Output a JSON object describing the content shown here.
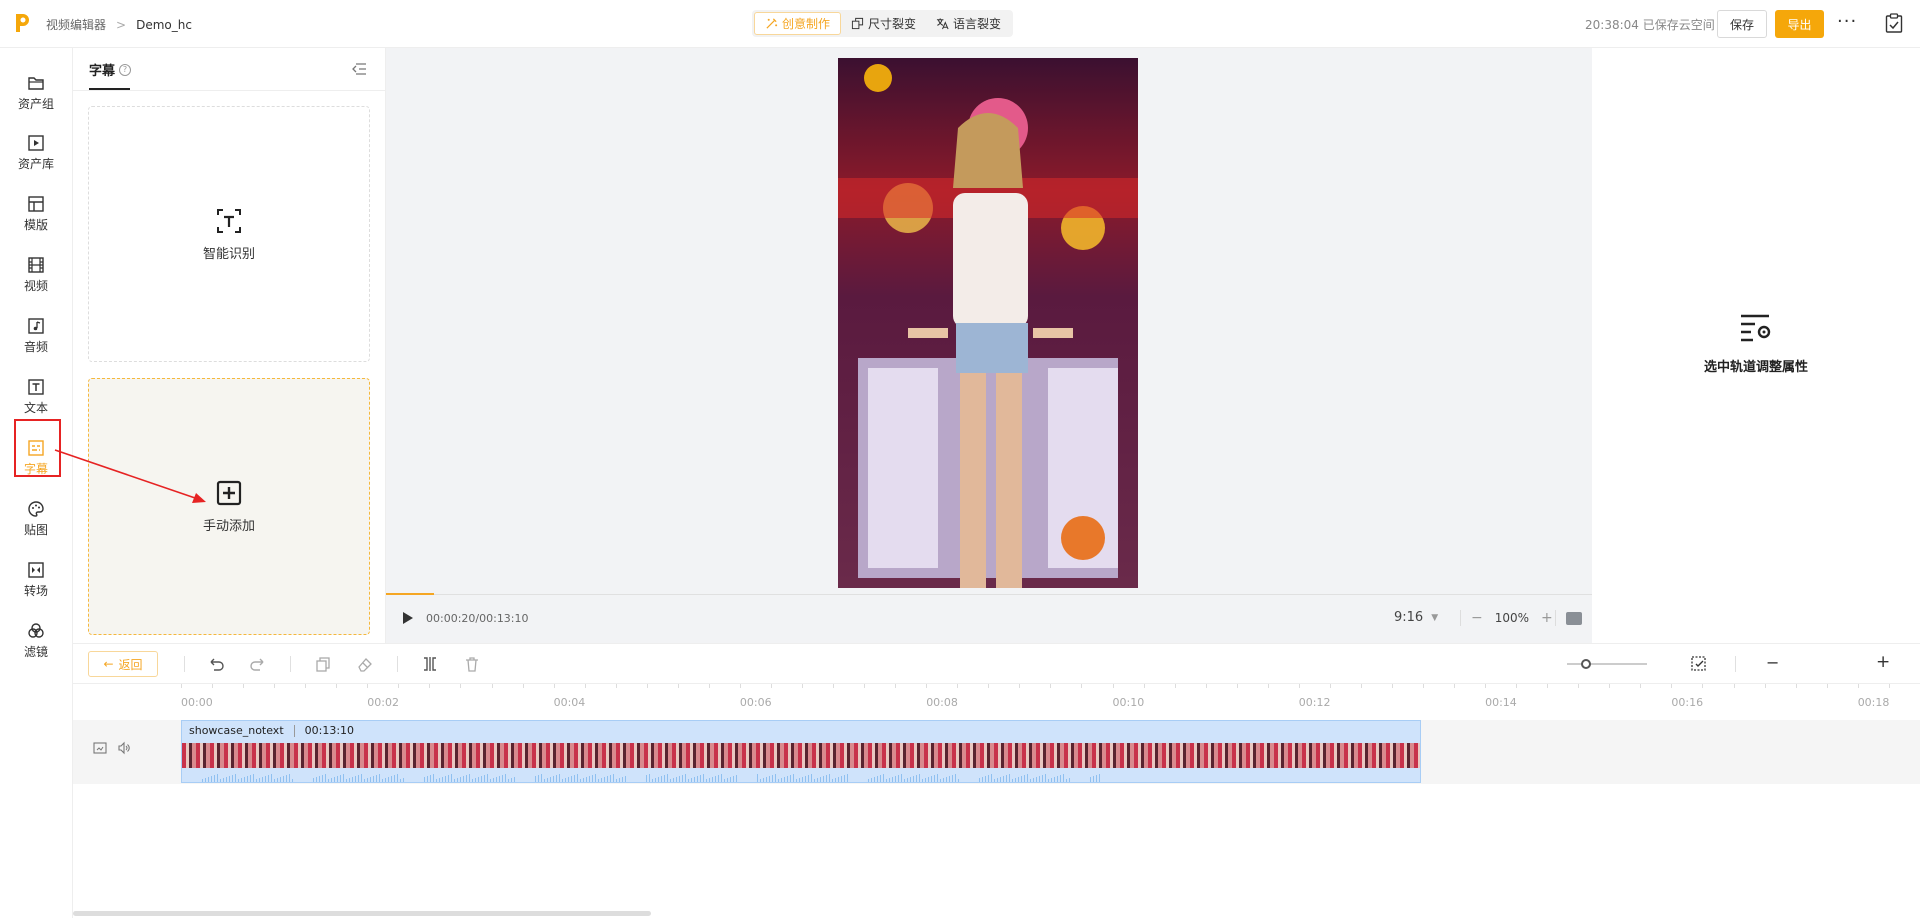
{
  "topbar": {
    "breadcrumb_root": "视频编辑器",
    "breadcrumb_sep": ">",
    "project_name": "Demo_hc",
    "modes": [
      {
        "label": "创意制作",
        "icon": "magic-icon",
        "active": true
      },
      {
        "label": "尺寸裂变",
        "icon": "resize-icon",
        "active": false
      },
      {
        "label": "语言裂变",
        "icon": "translate-icon",
        "active": false
      }
    ],
    "save_status": "20:38:04 已保存云空间",
    "save_label": "保存",
    "export_label": "导出",
    "more_label": "···",
    "accent_color": "#f5a70a"
  },
  "leftnav": {
    "items": [
      {
        "label": "资产组",
        "icon": "folder-icon"
      },
      {
        "label": "资产库",
        "icon": "play-square-icon"
      },
      {
        "label": "模版",
        "icon": "template-icon"
      },
      {
        "label": "视频",
        "icon": "film-icon"
      },
      {
        "label": "音频",
        "icon": "music-icon"
      },
      {
        "label": "文本",
        "icon": "text-icon"
      },
      {
        "label": "字幕",
        "icon": "subtitle-icon",
        "active": true
      },
      {
        "label": "贴图",
        "icon": "sticker-icon"
      },
      {
        "label": "转场",
        "icon": "transition-icon"
      },
      {
        "label": "滤镜",
        "icon": "filter-icon"
      }
    ]
  },
  "panel": {
    "tab_label": "字幕",
    "help_mark": "?",
    "auto_label": "智能识别",
    "manual_label": "手动添加"
  },
  "preview": {
    "time": "00:00:20/00:13:10",
    "ratio": "9:16",
    "zoom": "100%",
    "progress_fraction": 0.04
  },
  "props": {
    "empty_text": "选中轨道调整属性"
  },
  "toolbar": {
    "back_label": "返回"
  },
  "timeline": {
    "ticks": [
      "00:00",
      "00:02",
      "00:04",
      "00:06",
      "00:08",
      "00:10",
      "00:12",
      "00:14",
      "00:16",
      "00:18"
    ],
    "clip_name": "showcase_notext",
    "clip_duration": "00:13:10"
  }
}
